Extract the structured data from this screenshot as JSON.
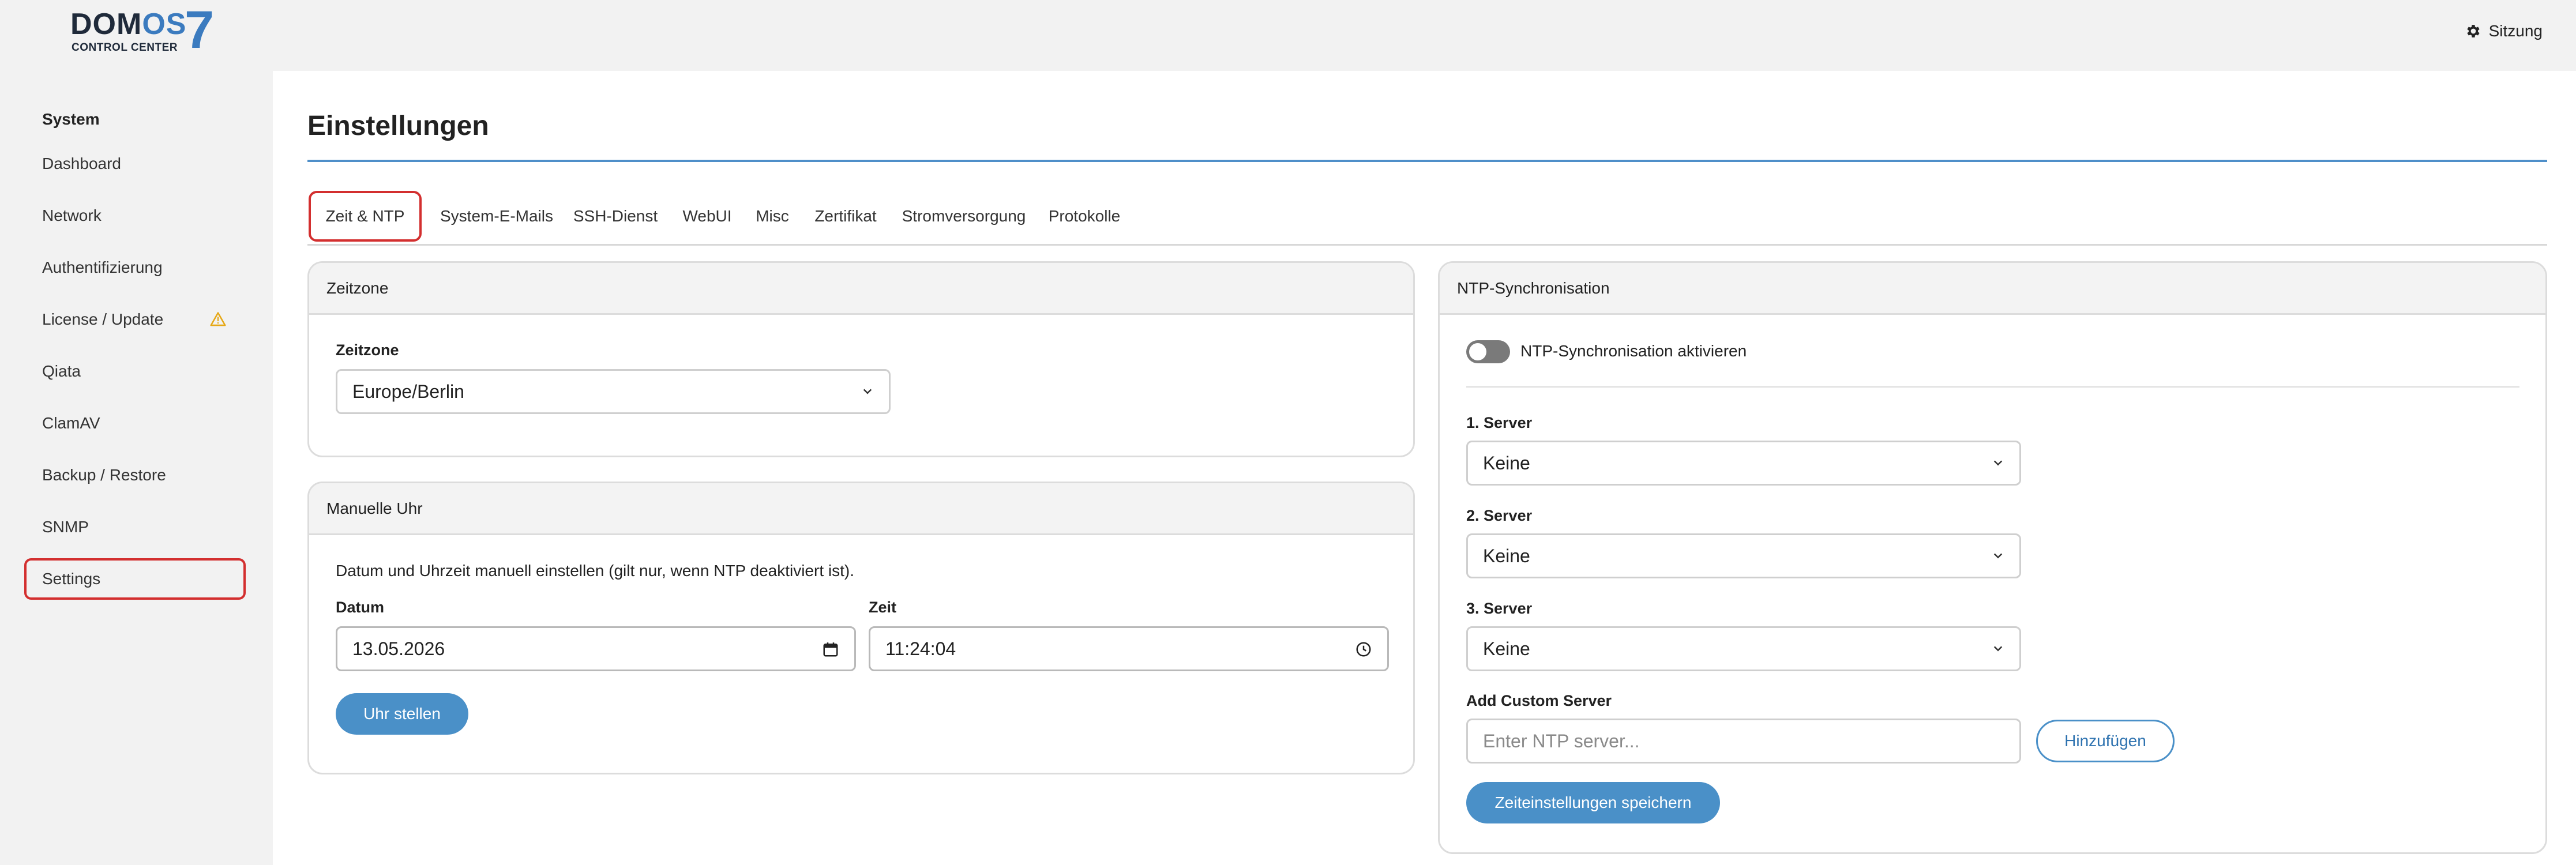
{
  "header": {
    "logo_word": "DOM",
    "logo_word_accent": "OS",
    "logo_number": "7",
    "logo_subtitle": "CONTROL CENTER",
    "session_label": "Sitzung",
    "session_icon": "gear-icon"
  },
  "sidebar": {
    "heading": "System",
    "items": [
      {
        "label": "Dashboard"
      },
      {
        "label": "Network"
      },
      {
        "label": "Authentifizierung"
      },
      {
        "label": "License / Update",
        "badge_icon": "warning-icon",
        "badge_color": "#e6a817"
      },
      {
        "label": "Qiata"
      },
      {
        "label": "ClamAV"
      },
      {
        "label": "Backup / Restore"
      },
      {
        "label": "SNMP"
      },
      {
        "label": "Settings"
      }
    ],
    "active_item": "Settings"
  },
  "page": {
    "title": "Einstellungen",
    "accent_color": "#4a90c8",
    "highlight_color": "#d32f2f"
  },
  "tabs": [
    {
      "label": "Zeit & NTP"
    },
    {
      "label": "System-E-Mails"
    },
    {
      "label": "SSH-Dienst"
    },
    {
      "label": "WebUI"
    },
    {
      "label": "Misc"
    },
    {
      "label": "Zertifikat"
    },
    {
      "label": "Stromversorgung"
    },
    {
      "label": "Protokolle"
    }
  ],
  "zeitzone_card": {
    "title": "Zeitzone",
    "field_label": "Zeitzone",
    "selected_value": "Europe/Berlin"
  },
  "manual_clock_card": {
    "title": "Manuelle Uhr",
    "description": "Datum und Uhrzeit manuell einstellen (gilt nur, wenn NTP deaktiviert ist).",
    "date_label": "Datum",
    "date_value": "13.05.2026",
    "time_label": "Zeit",
    "time_value": "11:24:04",
    "set_button": "Uhr stellen"
  },
  "ntp_card": {
    "title": "NTP-Synchronisation",
    "toggle_label": "NTP-Synchronisation aktivieren",
    "toggle_enabled": false,
    "servers": [
      {
        "label": "1. Server",
        "value": "Keine"
      },
      {
        "label": "2. Server",
        "value": "Keine"
      },
      {
        "label": "3. Server",
        "value": "Keine"
      }
    ],
    "custom_label": "Add Custom Server",
    "custom_placeholder": "Enter NTP server...",
    "add_button": "Hinzufügen",
    "save_button": "Zeiteinstellungen speichern"
  }
}
